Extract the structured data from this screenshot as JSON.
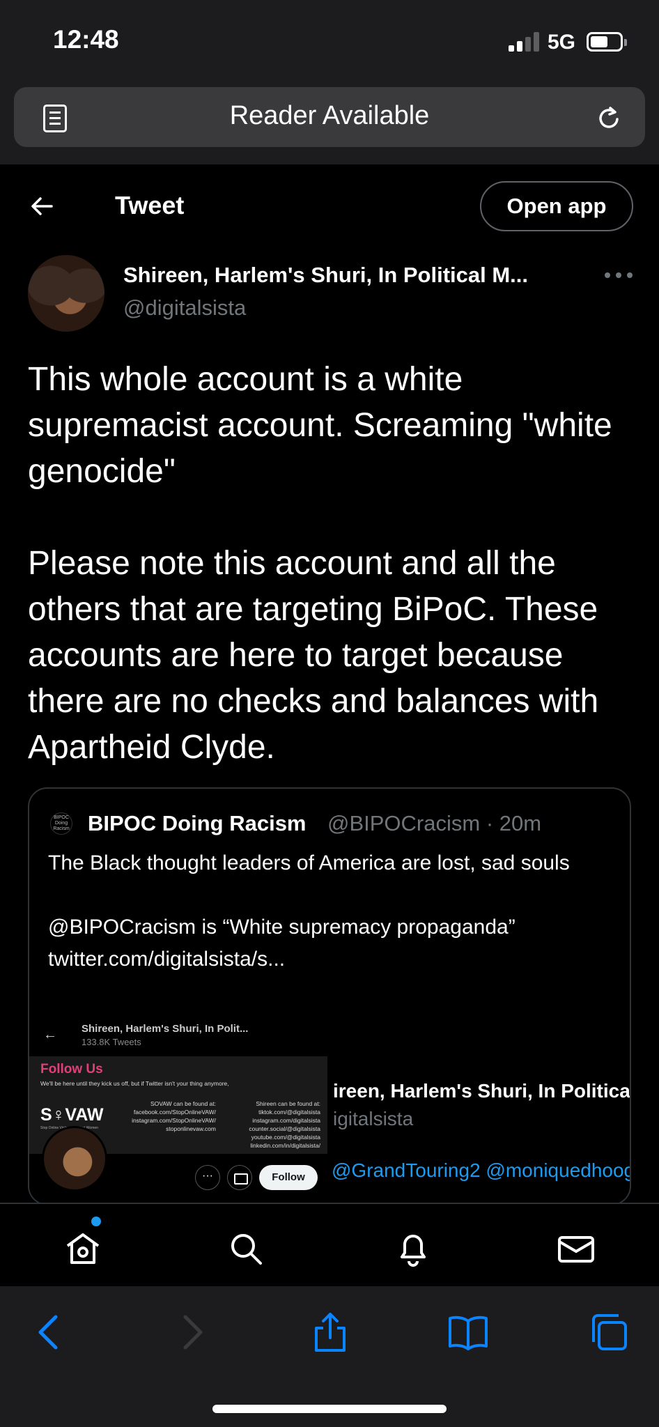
{
  "status_bar": {
    "time": "12:48",
    "network": "5G"
  },
  "browser": {
    "address_text": "Reader Available",
    "icons": [
      "reader-icon",
      "reload-icon"
    ]
  },
  "header": {
    "title": "Tweet",
    "open_app_label": "Open app"
  },
  "author": {
    "name": "Shireen, Harlem's Shuri, In Political M...",
    "handle": "@digitalsista"
  },
  "tweet": {
    "text": "This whole account is a white supremacist account. Screaming \"white genocide\"\n\nPlease note this account and all the others that are targeting BiPoC. These accounts are here to target because there are no checks and balances with Apartheid Clyde."
  },
  "quoted_tweet": {
    "avatar_text": "BIPOC Doing Racism",
    "name": "BIPOC Doing Racism",
    "meta": "@BIPOCracism · 20m",
    "text": "The Black thought leaders of America are lost, sad souls\n\n@BIPOCracism is “White supremacy propaganda” twitter.com/digitalsista/s...",
    "embedded_image": {
      "back_glyph": "←",
      "cut_title": "Shireen, Harlem's Shuri, In Polit...",
      "tweet_count": "133.8K Tweets",
      "banner": {
        "heading": "Follow Us",
        "subtext": "We'll be here until they kick us off, but if Twitter isn't your thing anymore,",
        "logo": "S♀VAW",
        "logo_tag": "Stop Online Violence Against Women",
        "col1": "SOVAW can be found at:\nfacebook.com/StopOnlineVAW/\ninstagram.com/StopOnlineVAW/\nstoponlinevaw.com",
        "col2": "Shireen can be found at:\ntiktok.com/@digitalsista\ninstagram.com/digitalsista\ncounter.social/@digitalsista\nyoutube.com/@digitalsista\nlinkedin.com/in/digitalsista/"
      },
      "more_glyph": "···",
      "follow_label": "Follow",
      "right_name": "ireen, Harlem's Shuri, In Politica",
      "right_handle": "igitalsista",
      "right_mentions": "@GrandTouring2 @moniquedhoog"
    }
  },
  "twitter_nav": {
    "items": [
      "home-icon",
      "search-icon",
      "notifications-icon",
      "messages-icon"
    ]
  },
  "safari_toolbar": {
    "items": [
      "back-icon",
      "forward-icon",
      "share-icon",
      "bookmarks-icon",
      "tabs-icon"
    ]
  },
  "colors": {
    "accent": "#1d9bf0",
    "background": "#000000",
    "toolbar": "#1c1c1e",
    "secondary_text": "#71767b"
  }
}
